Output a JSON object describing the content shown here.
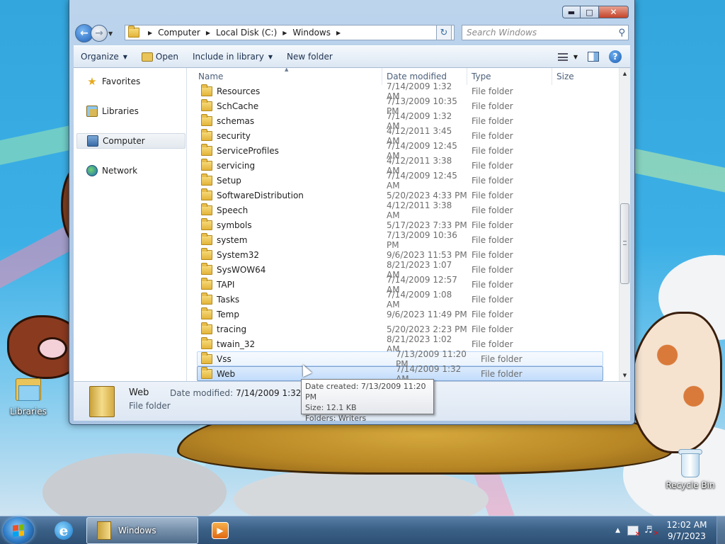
{
  "window": {
    "title_buttons": {
      "minimize": "▬",
      "maximize": "□",
      "close": "✕"
    }
  },
  "address": {
    "crumbs": [
      "Computer",
      "Local Disk (C:)",
      "Windows"
    ],
    "search_placeholder": "Search Windows"
  },
  "toolbar": {
    "organize": "Organize",
    "open": "Open",
    "include": "Include in library",
    "new_folder": "New folder"
  },
  "nav": {
    "items": [
      {
        "label": "Favorites",
        "icon": "star-icon"
      },
      {
        "label": "Libraries",
        "icon": "libraries-icon"
      },
      {
        "label": "Computer",
        "icon": "computer-icon"
      },
      {
        "label": "Network",
        "icon": "network-icon"
      }
    ]
  },
  "columns": {
    "name": "Name",
    "date": "Date modified",
    "type": "Type",
    "size": "Size"
  },
  "files": [
    {
      "name": "Resources",
      "date": "7/14/2009 1:32 AM",
      "type": "File folder"
    },
    {
      "name": "SchCache",
      "date": "7/13/2009 10:35 PM",
      "type": "File folder"
    },
    {
      "name": "schemas",
      "date": "7/14/2009 1:32 AM",
      "type": "File folder"
    },
    {
      "name": "security",
      "date": "4/12/2011 3:45 AM",
      "type": "File folder"
    },
    {
      "name": "ServiceProfiles",
      "date": "7/14/2009 12:45 AM",
      "type": "File folder"
    },
    {
      "name": "servicing",
      "date": "4/12/2011 3:38 AM",
      "type": "File folder"
    },
    {
      "name": "Setup",
      "date": "7/14/2009 12:45 AM",
      "type": "File folder"
    },
    {
      "name": "SoftwareDistribution",
      "date": "5/20/2023 4:33 PM",
      "type": "File folder"
    },
    {
      "name": "Speech",
      "date": "4/12/2011 3:38 AM",
      "type": "File folder"
    },
    {
      "name": "symbols",
      "date": "5/17/2023 7:33 PM",
      "type": "File folder"
    },
    {
      "name": "system",
      "date": "7/13/2009 10:36 PM",
      "type": "File folder"
    },
    {
      "name": "System32",
      "date": "9/6/2023 11:53 PM",
      "type": "File folder"
    },
    {
      "name": "SysWOW64",
      "date": "8/21/2023 1:07 AM",
      "type": "File folder"
    },
    {
      "name": "TAPI",
      "date": "7/14/2009 12:57 AM",
      "type": "File folder"
    },
    {
      "name": "Tasks",
      "date": "7/14/2009 1:08 AM",
      "type": "File folder"
    },
    {
      "name": "Temp",
      "date": "9/6/2023 11:49 PM",
      "type": "File folder"
    },
    {
      "name": "tracing",
      "date": "5/20/2023 2:23 PM",
      "type": "File folder"
    },
    {
      "name": "twain_32",
      "date": "8/21/2023 1:02 AM",
      "type": "File folder"
    },
    {
      "name": "Vss",
      "date": "7/13/2009 11:20 PM",
      "type": "File folder",
      "state": "hover"
    },
    {
      "name": "Web",
      "date": "7/14/2009 1:32 AM",
      "type": "File folder",
      "state": "selected"
    }
  ],
  "details": {
    "name": "Web",
    "type": "File folder",
    "modified_label": "Date modified:",
    "modified_value": "7/14/2009 1:32 AM"
  },
  "tooltip": {
    "line1": "Date created: 7/13/2009 11:20 PM",
    "line2": "Size: 12.1 KB",
    "line3": "Folders: Writers"
  },
  "desktop": {
    "icons": [
      {
        "label": "Libraries"
      },
      {
        "label": "Recycle Bin"
      }
    ]
  },
  "taskbar": {
    "explorer_label": "Windows",
    "time": "12:02 AM",
    "date": "9/7/2023"
  }
}
